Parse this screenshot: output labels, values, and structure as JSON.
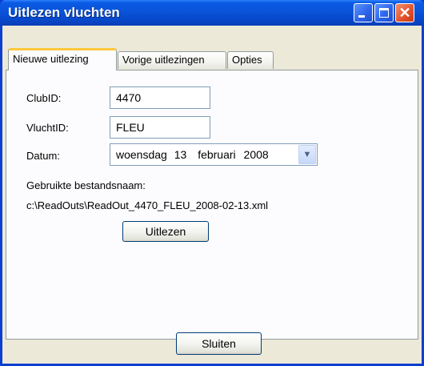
{
  "window": {
    "title": "Uitlezen vluchten"
  },
  "tabs": [
    {
      "label": "Nieuwe uitlezing",
      "active": true
    },
    {
      "label": "Vorige uitlezingen",
      "active": false
    },
    {
      "label": "Opties",
      "active": false
    }
  ],
  "form": {
    "club_label": "ClubID:",
    "club_value": "4470",
    "flight_label": "VluchtID:",
    "flight_value": "FLEU",
    "date_label": "Datum:",
    "date_day_name": "woensdag",
    "date_day": "13",
    "date_month": "februari",
    "date_year": "2008",
    "filename_label": "Gebruikte bestandsnaam:",
    "filename_value": "c:\\ReadOuts\\ReadOut_4470_FLEU_2008-02-13.xml",
    "read_button": "Uitlezen"
  },
  "footer": {
    "close_button": "Sluiten"
  },
  "colors": {
    "titlebar": "#0a53da",
    "active_tab_accent": "#ffc83c",
    "dialog_background": "#ece9d8"
  },
  "icons": {
    "minimize": "minimize-icon",
    "maximize": "maximize-icon",
    "close": "close-icon",
    "dropdown": "chevron-down-icon"
  }
}
